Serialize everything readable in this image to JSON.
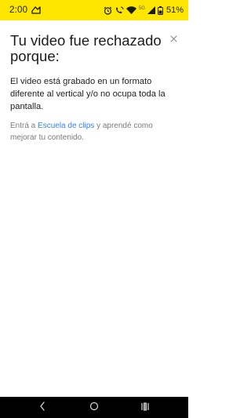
{
  "status_bar": {
    "time": "2:00",
    "battery": "51%",
    "network_label": "5G",
    "background_color": "#fee600",
    "left_icons": [
      "notification-icon"
    ],
    "right_icons": [
      "alarm-icon",
      "wifi-calling-icon",
      "wifi-icon",
      "signal-icon",
      "battery-icon"
    ]
  },
  "dialog": {
    "title": "Tu video fue rechazado porque:",
    "message": "El video está grabado en un formato diferente al vertical y/o no ocupa toda la pantalla.",
    "help": {
      "prefix": "Entrá a ",
      "link_text": "Escuela de clips",
      "suffix": " y aprendé como mejorar tu contenido."
    },
    "link_color": "#3483fa",
    "close_icon": "close-icon"
  },
  "nav_bar": {
    "icons": [
      "back-icon",
      "home-icon",
      "recents-icon"
    ]
  }
}
